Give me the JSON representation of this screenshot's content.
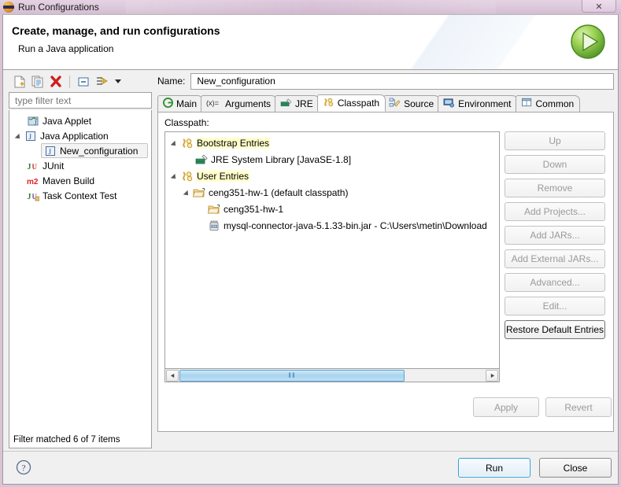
{
  "window": {
    "title": "Run Configurations",
    "title_icon": "eclipse-run-icon",
    "close_label": "✕"
  },
  "header": {
    "title": "Create, manage, and run configurations",
    "subtitle": "Run a Java application",
    "icon": "run-green-play-icon"
  },
  "left_panel": {
    "toolbar": [
      {
        "name": "new-configuration-icon",
        "tooltip": "New launch configuration"
      },
      {
        "name": "duplicate-configuration-icon",
        "tooltip": "Duplicate"
      },
      {
        "name": "delete-configuration-icon",
        "tooltip": "Delete"
      },
      {
        "name": "collapse-all-icon",
        "tooltip": "Collapse All"
      },
      {
        "name": "filter-icon",
        "tooltip": "Filter launch configurations"
      },
      {
        "name": "chevron-down-icon",
        "tooltip": "View Menu"
      }
    ],
    "filter": {
      "placeholder": "type filter text",
      "value": ""
    },
    "tree": [
      {
        "label": "Java Applet",
        "icon": "java-applet-icon",
        "depth": 1,
        "twisty": "none",
        "selected": false
      },
      {
        "label": "Java Application",
        "icon": "java-app-icon",
        "depth": 1,
        "twisty": "open",
        "selected": false
      },
      {
        "label": "New_configuration",
        "icon": "java-app-icon",
        "depth": 2,
        "twisty": "none",
        "selected": true
      },
      {
        "label": "JUnit",
        "icon": "junit-icon",
        "depth": 1,
        "twisty": "none",
        "selected": false
      },
      {
        "label": "Maven Build",
        "icon": "maven-icon",
        "depth": 1,
        "twisty": "none",
        "selected": false
      },
      {
        "label": "Task Context Test",
        "icon": "junit-context-icon",
        "depth": 1,
        "twisty": "none",
        "selected": false
      }
    ],
    "status": "Filter matched 6 of 7 items"
  },
  "name_field": {
    "label": "Name:",
    "value": "New_configuration",
    "placeholder": ""
  },
  "tabs": [
    {
      "label": "Main",
      "icon": "main-tab-icon",
      "active": false
    },
    {
      "label": "Arguments",
      "icon": "arguments-tab-icon",
      "active": false
    },
    {
      "label": "JRE",
      "icon": "jre-tab-icon",
      "active": false
    },
    {
      "label": "Classpath",
      "icon": "classpath-tab-icon",
      "active": true
    },
    {
      "label": "Source",
      "icon": "source-tab-icon",
      "active": false
    },
    {
      "label": "Environment",
      "icon": "environment-tab-icon",
      "active": false
    },
    {
      "label": "Common",
      "icon": "common-tab-icon",
      "active": false
    }
  ],
  "classpath": {
    "label": "Classpath:",
    "entries": [
      {
        "label": "Bootstrap Entries",
        "icon": "classpath-entries-icon",
        "depth": 0,
        "twisty": "open",
        "highlight": true
      },
      {
        "label": "JRE System Library [JavaSE-1.8]",
        "icon": "jre-library-icon",
        "depth": 2,
        "twisty": "none",
        "highlight": false
      },
      {
        "label": "User Entries",
        "icon": "classpath-entries-icon",
        "depth": 0,
        "twisty": "open",
        "highlight": true
      },
      {
        "label": "ceng351-hw-1 (default classpath)",
        "icon": "project-folder-icon",
        "depth": 1,
        "twisty": "open",
        "highlight": false
      },
      {
        "label": "ceng351-hw-1",
        "icon": "project-folder-icon",
        "depth": 3,
        "twisty": "none",
        "highlight": false
      },
      {
        "label": "mysql-connector-java-5.1.33-bin.jar - C:\\Users\\metin\\Download",
        "icon": "jar-icon",
        "depth": 3,
        "twisty": "none",
        "highlight": false
      }
    ],
    "scrollbar": {
      "left_arrow": "scroll-left-icon",
      "right_arrow": "scroll-right-icon",
      "grip": "‖‖"
    },
    "buttons": [
      {
        "label": "Up",
        "enabled": false
      },
      {
        "label": "Down",
        "enabled": false
      },
      {
        "label": "Remove",
        "enabled": false
      },
      {
        "label": "Add Projects...",
        "enabled": false
      },
      {
        "label": "Add JARs...",
        "enabled": false
      },
      {
        "label": "Add External JARs...",
        "enabled": false
      },
      {
        "label": "Advanced...",
        "enabled": false
      },
      {
        "label": "Edit...",
        "enabled": false
      },
      {
        "label": "Restore Default Entries",
        "enabled": true
      }
    ]
  },
  "apply_revert": [
    {
      "label": "Apply",
      "enabled": false
    },
    {
      "label": "Revert",
      "enabled": false
    }
  ],
  "footer": {
    "help_icon": "help-question-icon",
    "buttons": [
      {
        "label": "Run",
        "primary": true
      },
      {
        "label": "Close",
        "primary": false
      }
    ]
  },
  "colors": {
    "accent_blue": "#2f9fd6",
    "highlight_yellow": "#ffffcc",
    "titlebar": "#dcc8da",
    "dialog_bg": "#f0f0f0",
    "disabled_text": "#9a9a9a"
  }
}
